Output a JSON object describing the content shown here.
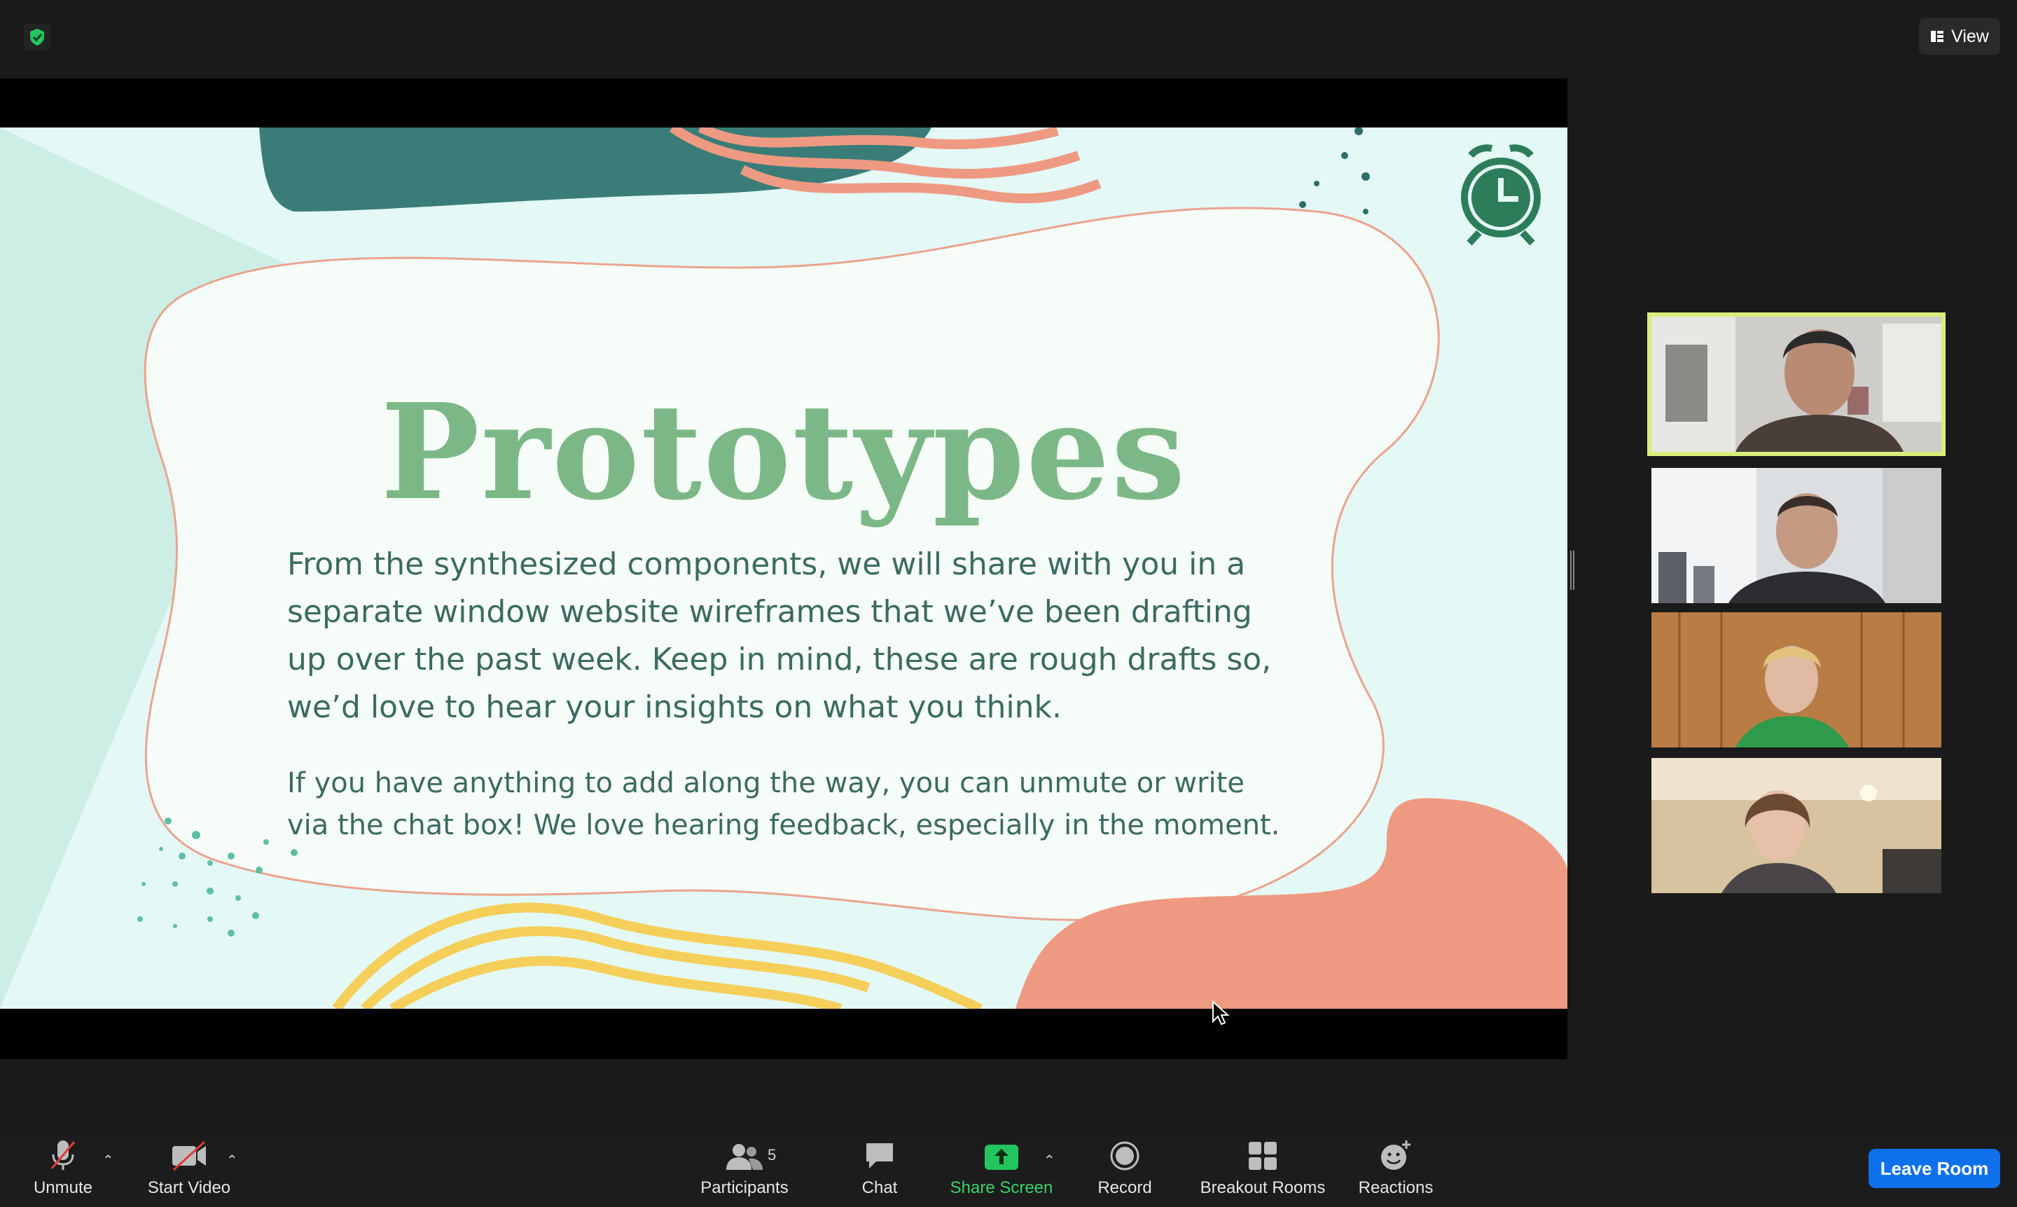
{
  "topbar": {
    "view_label": "View"
  },
  "slide": {
    "title": "Prototypes",
    "paragraph1": "From the synthesized components, we will share with you in a separate window website wireframes that we’ve been drafting up over the past week. Keep in mind, these are rough drafts so, we’d love to hear your insights on what you think.",
    "paragraph2": "If you have anything to add along the way, you can unmute or write via the chat box! We love hearing feedback, especially in the moment."
  },
  "toolbar": {
    "unmute": "Unmute",
    "start_video": "Start Video",
    "participants": "Participants",
    "participants_count": "5",
    "chat": "Chat",
    "share_screen": "Share Screen",
    "record": "Record",
    "breakout_rooms": "Breakout Rooms",
    "reactions": "Reactions",
    "leave": "Leave Room"
  },
  "colors": {
    "accent_green": "#37d36a",
    "leave_blue": "#0e71eb",
    "active_speaker": "#d9ee7a",
    "slide_title": "#7cb887",
    "slide_text": "#3c6a62"
  }
}
